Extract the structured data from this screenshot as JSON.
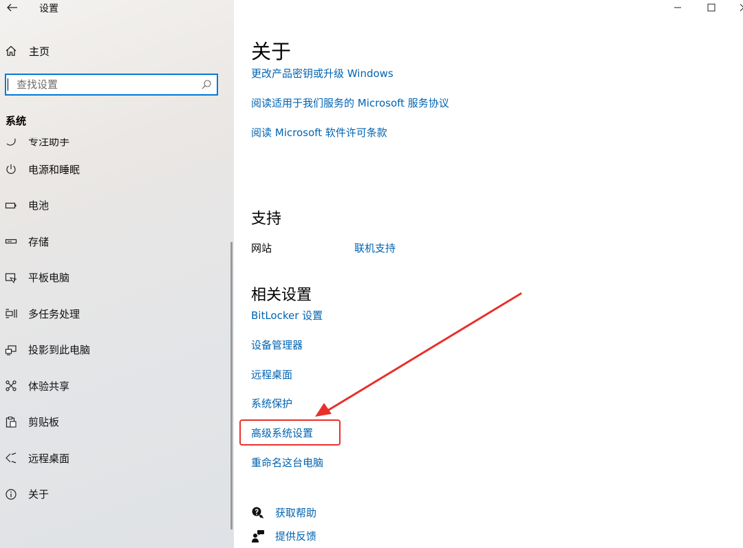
{
  "window": {
    "title": "设置",
    "minimize_glyph": "—",
    "maximize_glyph": "☐",
    "close_glyph": "✕"
  },
  "sidebar": {
    "home_label": "主页",
    "search": {
      "placeholder": "查找设置",
      "value": ""
    },
    "section_label": "系统",
    "items": [
      {
        "label": "专注助手",
        "icon": "moon-icon"
      },
      {
        "label": "电源和睡眠",
        "icon": "power-icon"
      },
      {
        "label": "电池",
        "icon": "battery-icon"
      },
      {
        "label": "存储",
        "icon": "storage-icon"
      },
      {
        "label": "平板电脑",
        "icon": "tablet-icon"
      },
      {
        "label": "多任务处理",
        "icon": "multitasking-icon"
      },
      {
        "label": "投影到此电脑",
        "icon": "projecting-icon"
      },
      {
        "label": "体验共享",
        "icon": "shared-experiences-icon"
      },
      {
        "label": "剪贴板",
        "icon": "clipboard-icon"
      },
      {
        "label": "远程桌面",
        "icon": "remote-desktop-icon"
      },
      {
        "label": "关于",
        "icon": "info-icon"
      }
    ]
  },
  "main": {
    "page_title": "关于",
    "top_links": [
      "更改产品密钥或升级 Windows",
      "阅读适用于我们服务的 Microsoft 服务协议",
      "阅读 Microsoft 软件许可条款"
    ],
    "support": {
      "heading": "支持",
      "website_label": "网站",
      "online_support_link": "联机支持"
    },
    "related": {
      "heading": "相关设置",
      "links": [
        "BitLocker 设置",
        "设备管理器",
        "远程桌面",
        "系统保护",
        "高级系统设置",
        "重命名这台电脑"
      ]
    },
    "help": {
      "get_help": "获取帮助",
      "give_feedback": "提供反馈"
    }
  },
  "colors": {
    "link": "#0063b1",
    "accent": "#0078d7",
    "annotation": "#e8302a"
  }
}
